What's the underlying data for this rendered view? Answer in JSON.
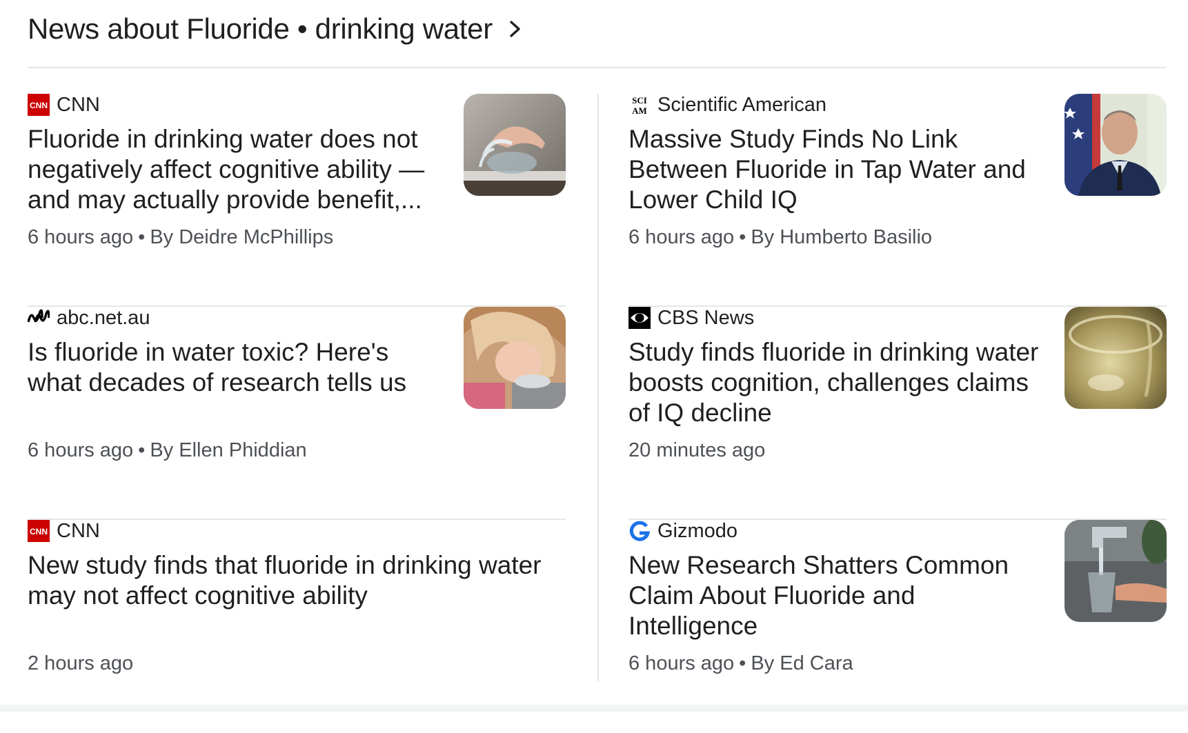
{
  "header": {
    "title": "News about Fluoride • drinking water"
  },
  "columns": [
    [
      {
        "source": "CNN",
        "logo_icon": "cnn-logo-icon",
        "headline": "Fluoride in drinking water does not negatively affect cognitive ability — and may actually provide benefit,...",
        "time": "6 hours ago",
        "byline": "By Deidre McPhillips",
        "thumbnail": "drinking-fountain-image"
      },
      {
        "source": "abc.net.au",
        "logo_icon": "abc-logo-icon",
        "headline": "Is fluoride in water toxic? Here's what decades of research tells us",
        "time": "6 hours ago",
        "byline": "By Ellen Phiddian",
        "thumbnail": "child-drinking-image"
      },
      {
        "source": "CNN",
        "logo_icon": "cnn-logo-icon",
        "headline": "New study finds that fluoride in drinking water may not affect cognitive ability",
        "time": "2 hours ago",
        "byline": ""
      }
    ],
    [
      {
        "source": "Scientific American",
        "logo_icon": "sciam-logo-icon",
        "headline": "Massive Study Finds No Link Between Fluoride in Tap Water and Lower Child IQ",
        "time": "6 hours ago",
        "byline": "By Humberto Basilio",
        "thumbnail": "portrait-image"
      },
      {
        "source": "CBS News",
        "logo_icon": "cbs-eye-logo-icon",
        "headline": "Study finds fluoride in drinking water boosts cognition, challenges claims of IQ decline",
        "time": "20 minutes ago",
        "byline": "",
        "thumbnail": "water-glass-image"
      },
      {
        "source": "Gizmodo",
        "logo_icon": "gizmodo-logo-icon",
        "headline": "New Research Shatters Common Claim About Fluoride and Intelligence",
        "time": "6 hours ago",
        "byline": "By Ed Cara",
        "thumbnail": "tap-water-image"
      }
    ]
  ],
  "colors": {
    "cnn_red": "#cc0000",
    "gizmodo_blue": "#1a73e8",
    "divider": "#e6e6e6",
    "meta_text": "#4d5156"
  }
}
